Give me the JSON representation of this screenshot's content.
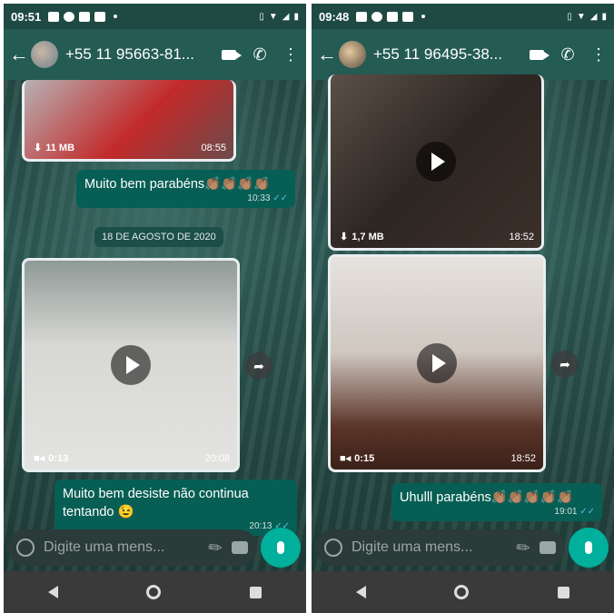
{
  "left": {
    "status": {
      "time": "09:51"
    },
    "header": {
      "contact": "+55 11 95663-81..."
    },
    "video_top": {
      "size": "11 MB",
      "time": "08:55"
    },
    "msg1": {
      "text": "Muito bem parabéns👏🏽👏🏽👏🏽👏🏽",
      "time": "10:33"
    },
    "date_chip": "18 DE AGOSTO DE 2020",
    "video_main": {
      "duration": "0:13",
      "time": "20:08"
    },
    "msg2": {
      "text": "Muito bem desiste não continua tentando 😉",
      "time": "20:13"
    },
    "input": {
      "placeholder": "Digite uma mens..."
    }
  },
  "right": {
    "status": {
      "time": "09:48"
    },
    "header": {
      "contact": "+55 11 96495-38..."
    },
    "video_top": {
      "size": "1,7 MB",
      "time": "18:52"
    },
    "video_main": {
      "duration": "0:15",
      "time": "18:52"
    },
    "msg1": {
      "text": "Uhulll parabéns👏🏽👏🏽👏🏽👏🏽👏🏽",
      "time": "19:01"
    },
    "input": {
      "placeholder": "Digite uma mens..."
    }
  },
  "colors": {
    "header": "#245b53",
    "bubble": "#075e54",
    "mic": "#00af9c",
    "ticks": "#53bdeb"
  }
}
